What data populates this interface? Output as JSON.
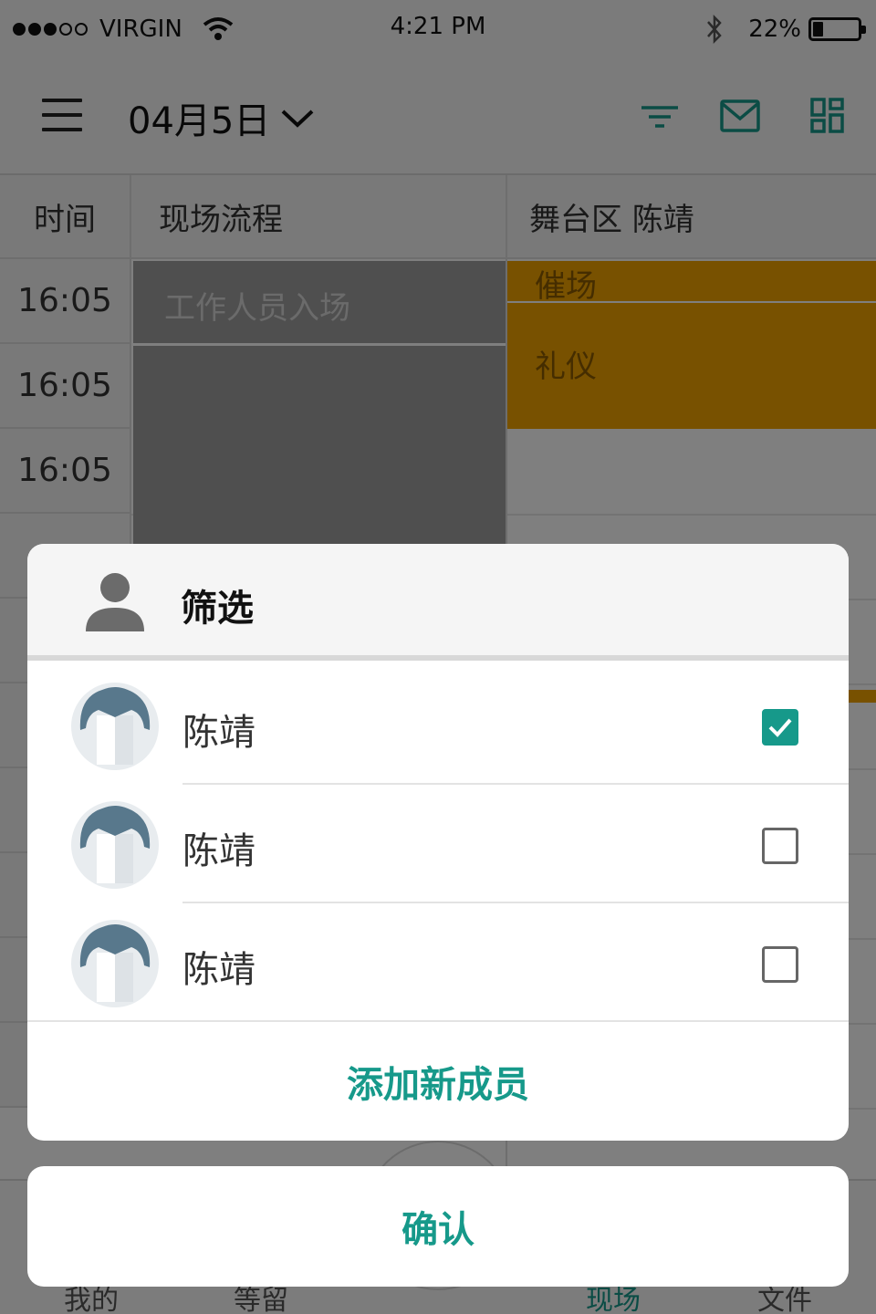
{
  "status_bar": {
    "carrier": "VIRGIN",
    "time": "4:21 PM",
    "battery": "22%",
    "battery_level": 0.22,
    "signal_bars": 3
  },
  "nav": {
    "date": "04月5日",
    "icons": [
      "menu-icon",
      "chevron-down-icon",
      "filter-icon",
      "mail-icon",
      "grid-view-icon"
    ]
  },
  "schedule": {
    "headers": [
      "时间",
      "现场流程",
      "舞台区  陈靖"
    ],
    "times": [
      "16:05",
      "16:05",
      "16:05"
    ],
    "events": {
      "staff_entry": "工作人员入场",
      "call": "催场",
      "etiquette": "礼仪"
    }
  },
  "tabbar": {
    "items": [
      "我的",
      "等留",
      "现场",
      "文件"
    ],
    "active": "现场"
  },
  "filter_sheet": {
    "title": "筛选",
    "members": [
      {
        "name": "陈靖",
        "checked": true
      },
      {
        "name": "陈靖",
        "checked": false
      },
      {
        "name": "陈靖",
        "checked": false
      }
    ],
    "add_label": "添加新成员",
    "confirm_label": "确认"
  },
  "colors": {
    "accent": "#16998a",
    "event_orange": "#f0a200",
    "event_gray": "#9e9e9e"
  }
}
